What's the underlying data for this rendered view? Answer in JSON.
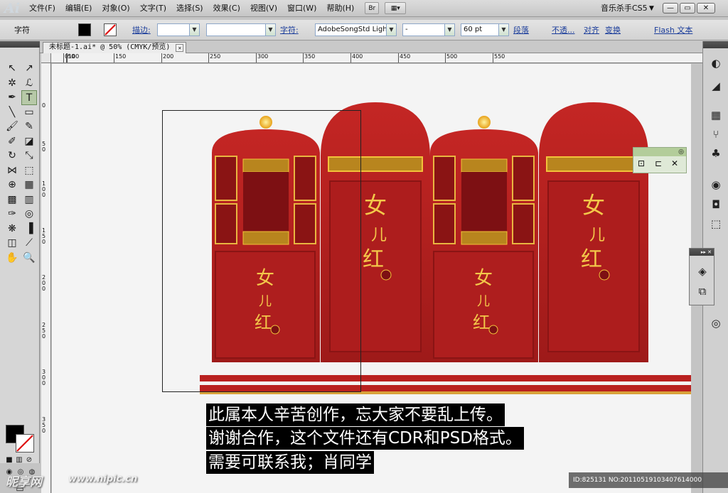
{
  "app": {
    "logo": "Ai",
    "menus": [
      "文件(F)",
      "编辑(E)",
      "对象(O)",
      "文字(T)",
      "选择(S)",
      "效果(C)",
      "视图(V)",
      "窗口(W)",
      "帮助(H)"
    ],
    "bridge_button": "Br",
    "workspace_name": "音乐杀手CS5",
    "window_controls": [
      "—",
      "▭",
      "✕"
    ]
  },
  "control_bar": {
    "tool_label": "字符",
    "stroke_label": "描边:",
    "character_label": "字符:",
    "font_family": "AdobeSongStd Light*",
    "font_style": "-",
    "font_size": "60 pt",
    "paragraph_label": "段落",
    "opacity_label": "不透...",
    "align_label": "对齐",
    "transform_label": "变换",
    "flash_text_label": "Flash 文本"
  },
  "document": {
    "tab_title": "未标题-1.ai* @ 50% (CMYK/预览)",
    "tab_close": "✕",
    "ruler_h_ticks": [
      "0",
      "50",
      "100",
      "150",
      "200",
      "250",
      "300",
      "350",
      "400",
      "450",
      "500",
      "550"
    ],
    "ruler_v_ticks": [
      "0",
      "50",
      "100",
      "150",
      "200",
      "250",
      "300",
      "350"
    ]
  },
  "tools": [
    {
      "name": "selection-tool",
      "glyph": "↖"
    },
    {
      "name": "direct-selection-tool",
      "glyph": "↗"
    },
    {
      "name": "magic-wand-tool",
      "glyph": "✲"
    },
    {
      "name": "lasso-tool",
      "glyph": "ℒ"
    },
    {
      "name": "pen-tool",
      "glyph": "✒"
    },
    {
      "name": "type-tool",
      "glyph": "T"
    },
    {
      "name": "line-tool",
      "glyph": "╲"
    },
    {
      "name": "rectangle-tool",
      "glyph": "▭"
    },
    {
      "name": "paintbrush-tool",
      "glyph": "🖌"
    },
    {
      "name": "pencil-tool",
      "glyph": "✎"
    },
    {
      "name": "blob-brush-tool",
      "glyph": "✐"
    },
    {
      "name": "eraser-tool",
      "glyph": "◪"
    },
    {
      "name": "rotate-tool",
      "glyph": "↻"
    },
    {
      "name": "scale-tool",
      "glyph": "⤡"
    },
    {
      "name": "width-tool",
      "glyph": "⋈"
    },
    {
      "name": "free-transform-tool",
      "glyph": "⬚"
    },
    {
      "name": "shape-builder-tool",
      "glyph": "⊕"
    },
    {
      "name": "perspective-grid-tool",
      "glyph": "▦"
    },
    {
      "name": "mesh-tool",
      "glyph": "▩"
    },
    {
      "name": "gradient-tool",
      "glyph": "▥"
    },
    {
      "name": "eyedropper-tool",
      "glyph": "✑"
    },
    {
      "name": "blend-tool",
      "glyph": "◎"
    },
    {
      "name": "symbol-sprayer-tool",
      "glyph": "❋"
    },
    {
      "name": "column-graph-tool",
      "glyph": "▐"
    },
    {
      "name": "artboard-tool",
      "glyph": "◫"
    },
    {
      "name": "slice-tool",
      "glyph": "⟋"
    },
    {
      "name": "hand-tool",
      "glyph": "✋"
    },
    {
      "name": "zoom-tool",
      "glyph": "🔍"
    }
  ],
  "dock_icons": [
    "color-icon",
    "color-guide-icon",
    "swatches-icon",
    "brushes-icon",
    "symbols-icon",
    "stroke-icon",
    "gradient-icon",
    "transparency-icon",
    "appearance-icon",
    "graphic-styles-icon",
    "layers-icon",
    "artboards-icon",
    "pathfinder-icon"
  ],
  "notice": {
    "line1": "此属本人辛苦创作，忘大家不要乱上传。",
    "line2": "谢谢合作，这个文件还有CDR和PSD格式。",
    "line3": "需要可联系我；肖同学"
  },
  "watermark": {
    "logo": "昵享网",
    "url": "www.nipic.cn",
    "id_text": "ID:825131 NO:20110519103407614000"
  },
  "colors": {
    "art_red": "#b3201f",
    "art_gold": "#f2c23a",
    "panel_gray": "#d6d6d6"
  }
}
